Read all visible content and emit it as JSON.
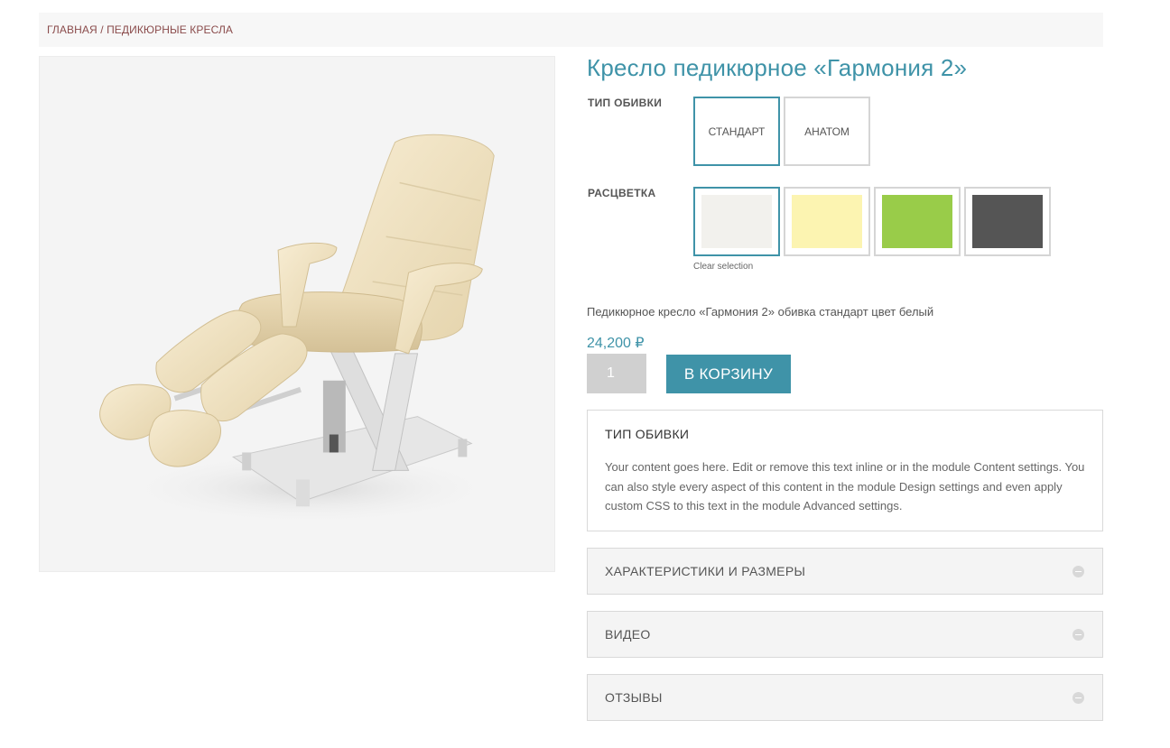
{
  "breadcrumb": {
    "home": "ГЛАВНАЯ",
    "separator": "/",
    "current": "ПЕДИКЮРНЫЕ КРЕСЛА"
  },
  "product": {
    "title": "Кресло педикюрное «Гармония 2»",
    "image_icon": "pedicure-chair-photo",
    "variation_description": "Педикюрное кресло «Гармония 2» обивка стандарт цвет белый",
    "price": "24,200 ₽",
    "quantity": "1",
    "add_to_cart_label": "В КОРЗИНУ"
  },
  "attributes": {
    "upholstery": {
      "label": "ТИП ОБИВКИ",
      "options": [
        "СТАНДАРТ",
        "АНАТОМ"
      ],
      "selected": "СТАНДАРТ"
    },
    "color": {
      "label": "РАСЦВЕТКА",
      "swatches": [
        "#f2f1ed",
        "#fcf4b1",
        "#99cc49",
        "#555555"
      ],
      "selected_index": 0,
      "clear_label": "Clear selection"
    }
  },
  "tabs": {
    "open": {
      "title": "ТИП ОБИВКИ",
      "body": "Your content goes here. Edit or remove this text inline or in the module Content settings. You can also style every aspect of this content in the module Design settings and even apply custom CSS to this text in the module Advanced settings."
    },
    "closed": [
      {
        "title": "ХАРАКТЕРИСТИКИ И РАЗМЕРЫ"
      },
      {
        "title": "ВИДЕО"
      },
      {
        "title": "ОТЗЫВЫ"
      }
    ]
  },
  "colors": {
    "accent": "#3f93a8",
    "breadcrumb": "#8a4b4b"
  }
}
